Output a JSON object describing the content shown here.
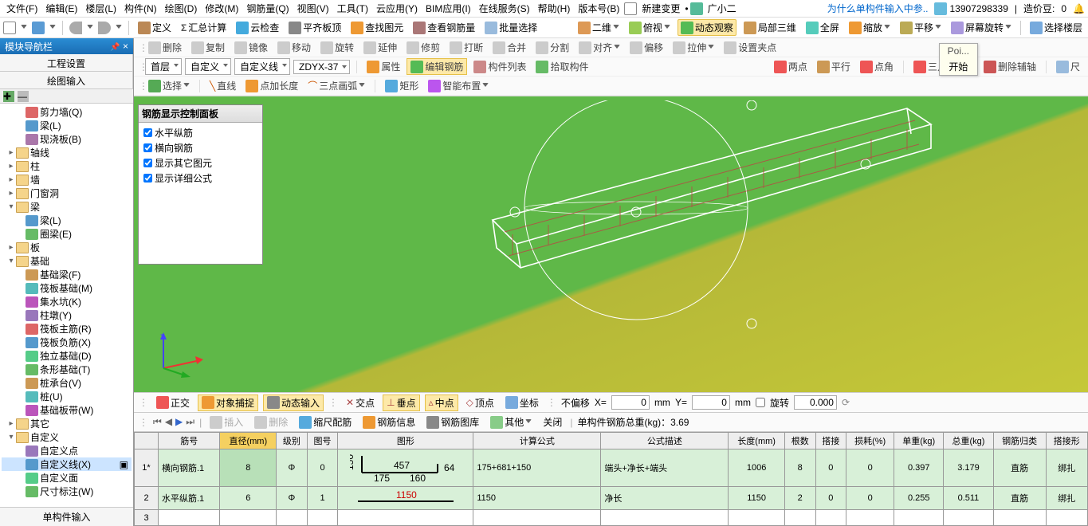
{
  "menu": {
    "items": [
      "文件(F)",
      "编辑(E)",
      "楼层(L)",
      "构件(N)",
      "绘图(D)",
      "修改(M)",
      "钢筋量(Q)",
      "视图(V)",
      "工具(T)",
      "云应用(Y)",
      "BIM应用(I)",
      "在线服务(S)",
      "帮助(H)",
      "版本号(B)"
    ],
    "new_change": "新建变更",
    "guangxiaoer": "广小二",
    "hint": "为什么单构件输入中参..",
    "user": "13907298339",
    "credit_label": "造价豆:",
    "credit": "0"
  },
  "tb1": {
    "define": "定义",
    "sumcalc": "汇总计算",
    "cloudcheck": "云检查",
    "flatten": "平齐板顶",
    "findel": "查找图元",
    "viewrebar": "查看钢筋量",
    "batchsel": "批量选择",
    "twoD": "二维",
    "threeD": "俯视",
    "dynview": "动态观察",
    "local3d": "局部三维",
    "fullscreen": "全屏",
    "zoom": "缩放",
    "pan": "平移",
    "scrrotate": "屏幕旋转",
    "selfloor": "选择楼层"
  },
  "rib1": {
    "del": "删除",
    "copy": "复制",
    "mirror": "镜像",
    "move": "移动",
    "rotate": "旋转",
    "extend": "延伸",
    "trim": "修剪",
    "break": "打断",
    "merge": "合并",
    "split": "分割",
    "align": "对齐",
    "offset": "偏移",
    "stretch": "拉伸",
    "setpin": "设置夹点"
  },
  "rib2": {
    "floor": "首层",
    "cat": "自定义",
    "sub": "自定义线",
    "code": "ZDYX-37",
    "prop": "属性",
    "editrebar": "编辑钢筋",
    "complist": "构件列表",
    "pick": "拾取构件",
    "twopt": "两点",
    "parallel": "平行",
    "ptang": "点角",
    "threept": "三点辅轴",
    "delaux": "删除辅轴",
    "dim": "尺"
  },
  "rib3": {
    "select": "选择",
    "line": "直线",
    "ptlen": "点加长度",
    "arc3": "三点画弧",
    "rect": "矩形",
    "smart": "智能布置"
  },
  "tooltip": {
    "hd": "Poi...",
    "bd": "开始"
  },
  "nav": {
    "title": "模块导航栏",
    "t1": "工程设置",
    "t2": "绘图输入",
    "bottom": "单构件输入"
  },
  "tree": {
    "n1": "剪力墙(Q)",
    "n2": "梁(L)",
    "n3": "现浇板(B)",
    "n4": "轴线",
    "n5": "柱",
    "n6": "墙",
    "n7": "门窗洞",
    "n8": "梁",
    "n8a": "梁(L)",
    "n8b": "圈梁(E)",
    "n9": "板",
    "n10": "基础",
    "n10a": "基础梁(F)",
    "n10b": "筏板基础(M)",
    "n10c": "集水坑(K)",
    "n10d": "柱墩(Y)",
    "n10e": "筏板主筋(R)",
    "n10f": "筏板负筋(X)",
    "n10g": "独立基础(D)",
    "n10h": "条形基础(T)",
    "n10i": "桩承台(V)",
    "n10j": "桩(U)",
    "n10k": "基础板带(W)",
    "n11": "其它",
    "n12": "自定义",
    "n12a": "自定义点",
    "n12b": "自定义线(X)",
    "n12c": "自定义面",
    "n12d": "尺寸标注(W)"
  },
  "panel": {
    "title": "钢筋显示控制面板",
    "c1": "水平纵筋",
    "c2": "横向钢筋",
    "c3": "显示其它图元",
    "c4": "显示详细公式"
  },
  "sb": {
    "ortho": "正交",
    "osnap": "对象捕捉",
    "dynin": "动态输入",
    "cross": "交点",
    "perp": "垂点",
    "mid": "中点",
    "vert": "顶点",
    "coord": "坐标",
    "nooff": "不偏移",
    "x": "X=",
    "y": "Y=",
    "mm": "mm",
    "rot": "旋转",
    "xv": "0",
    "yv": "0",
    "rv": "0.000"
  },
  "tt": {
    "ins": "插入",
    "del": "删除",
    "scldim": "缩尺配筋",
    "rebarinfo": "钢筋信息",
    "rebarlib": "钢筋图库",
    "other": "其他",
    "close": "关闭",
    "total": "单构件钢筋总重(kg)：3.69"
  },
  "grid": {
    "h": [
      "",
      "筋号",
      "直径(mm)",
      "级别",
      "图号",
      "图形",
      "计算公式",
      "公式描述",
      "长度(mm)",
      "根数",
      "搭接",
      "损耗(%)",
      "单重(kg)",
      "总重(kg)",
      "钢筋归类",
      "搭接形"
    ],
    "r1": {
      "idx": "1*",
      "name": "横向钢筋.1",
      "dia": "8",
      "lvl": "Φ",
      "fig": "0",
      "formula": "175+681+150",
      "desc": "端头+净长+端头",
      "len": "1006",
      "qty": "8",
      "lap": "0",
      "loss": "0",
      "uw": "0.397",
      "tw": "3.179",
      "cat": "直筋",
      "st": "绑扎",
      "shape": {
        "a": "150",
        "b": "457",
        "c": "64",
        "d": "175",
        "e": "160"
      }
    },
    "r2": {
      "idx": "2",
      "name": "水平纵筋.1",
      "dia": "6",
      "lvl": "Φ",
      "fig": "1",
      "formula": "1150",
      "desc": "净长",
      "len": "1150",
      "qty": "2",
      "lap": "0",
      "loss": "0",
      "uw": "0.255",
      "tw": "0.511",
      "cat": "直筋",
      "st": "绑扎",
      "shape": {
        "a": "1150"
      }
    },
    "r3": {
      "idx": "3"
    }
  }
}
